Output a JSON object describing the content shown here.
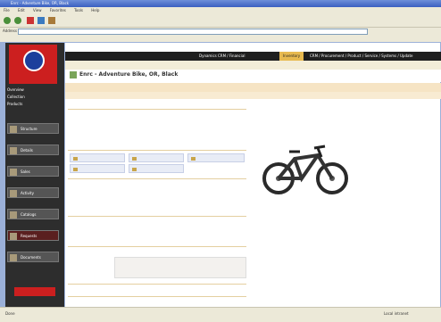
{
  "window": {
    "title": "Enrc - Adventure Bike, OR, Black"
  },
  "menu": [
    "File",
    "Edit",
    "View",
    "Favorites",
    "Tools",
    "Help"
  ],
  "addressbar": {
    "label": "Address",
    "url": ""
  },
  "topnav": {
    "tabs": [
      "Dynamics CRM / Financial",
      "Inventory",
      "CRM / Procurement / Product / Service / Systems / Update"
    ],
    "active_index": 1
  },
  "product": {
    "title": "Enrc - Adventure Bike, OR, Black"
  },
  "sidebar": {
    "links": [
      "Overview",
      "Collection",
      "Products"
    ],
    "buttons": [
      "Structure",
      "Details",
      "Sales",
      "Activity",
      "Catalogs",
      "Requests",
      "Documents"
    ]
  },
  "statusbar": {
    "left": "Done",
    "right": "Local intranet"
  },
  "colors": {
    "accent": "#e7b94f",
    "brand": "#cc1f1f",
    "nav_bg": "#1e1e1e"
  }
}
